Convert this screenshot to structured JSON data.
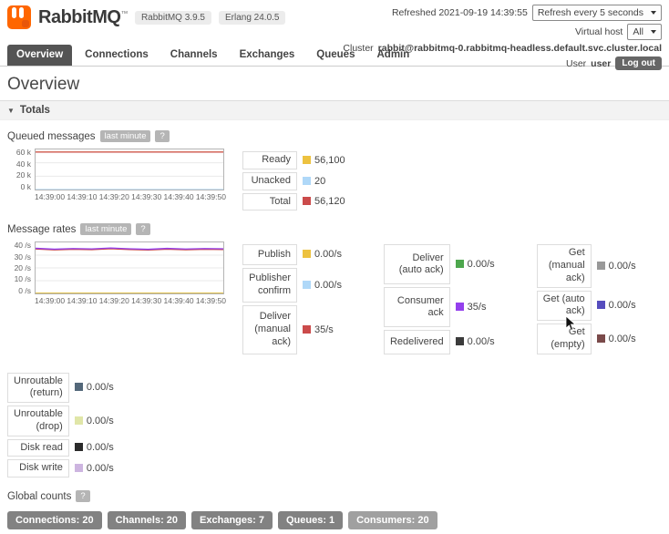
{
  "header": {
    "brand": "RabbitMQ",
    "tm": "™",
    "version_rabbitmq": "RabbitMQ 3.9.5",
    "version_erlang": "Erlang 24.0.5",
    "refreshed": "Refreshed 2021-09-19 14:39:55",
    "refresh_select": "Refresh every 5 seconds",
    "virtual_host_label": "Virtual host",
    "virtual_host_select": "All",
    "cluster_label": "Cluster",
    "cluster_value": "rabbit@rabbitmq-0.rabbitmq-headless.default.svc.cluster.local",
    "user_label": "User",
    "user_value": "user",
    "logout": "Log out"
  },
  "nav": {
    "tabs": [
      {
        "label": "Overview"
      },
      {
        "label": "Connections"
      },
      {
        "label": "Channels"
      },
      {
        "label": "Exchanges"
      },
      {
        "label": "Queues"
      },
      {
        "label": "Admin"
      }
    ]
  },
  "page": {
    "title": "Overview"
  },
  "totals": {
    "label": "Totals",
    "caret": "▼"
  },
  "queued": {
    "range_badge": "last minute",
    "help": "?",
    "legend": [
      {
        "label": "Ready",
        "value": "56,100",
        "color": "#edc240"
      },
      {
        "label": "Unacked",
        "value": "20",
        "color": "#afd8f8"
      },
      {
        "label": "Total",
        "value": "56,120",
        "color": "#cb4b4b"
      }
    ]
  },
  "rates": {
    "range_badge": "last minute",
    "help": "?",
    "columns": [
      {
        "rows": [
          {
            "label": "Publish",
            "value": "0.00/s",
            "color": "#edc240"
          },
          {
            "label": "Publisher confirm",
            "value": "0.00/s",
            "color": "#afd8f8"
          },
          {
            "label": "Deliver (manual ack)",
            "value": "35/s",
            "color": "#cb4b4b"
          }
        ]
      },
      {
        "rows": [
          {
            "label": "Deliver (auto ack)",
            "value": "0.00/s",
            "color": "#4da74d"
          },
          {
            "label": "Consumer ack",
            "value": "35/s",
            "color": "#9440ed"
          },
          {
            "label": "Redelivered",
            "value": "0.00/s",
            "color": "#3b3b3b"
          }
        ]
      },
      {
        "rows": [
          {
            "label": "Get (manual ack)",
            "value": "0.00/s",
            "color": "#999999"
          },
          {
            "label": "Get (auto ack)",
            "value": "0.00/s",
            "color": "#564dbe"
          },
          {
            "label": "Get (empty)",
            "value": "0.00/s",
            "color": "#7a4a4a"
          }
        ]
      }
    ],
    "extra": [
      {
        "label": "Unroutable (return)",
        "value": "0.00/s",
        "color": "#54687a"
      },
      {
        "label": "Unroutable (drop)",
        "value": "0.00/s",
        "color": "#e0e6a8"
      },
      {
        "label": "Disk read",
        "value": "0.00/s",
        "color": "#2b2b2b"
      },
      {
        "label": "Disk write",
        "value": "0.00/s",
        "color": "#cdb5e0"
      }
    ]
  },
  "global_counts": {
    "title": "Global counts",
    "help": "?",
    "badges": [
      {
        "label": "Connections: 20",
        "color": "#828282"
      },
      {
        "label": "Channels: 20",
        "color": "#828282"
      },
      {
        "label": "Exchanges: 7",
        "color": "#828282"
      },
      {
        "label": "Queues: 1",
        "color": "#828282"
      },
      {
        "label": "Consumers: 20",
        "color": "#a0a0a0"
      }
    ]
  },
  "chart_data": [
    {
      "type": "line",
      "title": "Queued messages",
      "ylim": [
        0,
        60000
      ],
      "y_ticks": [
        "60 k",
        "40 k",
        "20 k",
        "0 k"
      ],
      "x_ticks": [
        "14:39:00",
        "14:39:10",
        "14:39:20",
        "14:39:30",
        "14:39:40",
        "14:39:50"
      ],
      "series": [
        {
          "name": "Total",
          "color": "#cb4b4b",
          "values": [
            56120,
            56118,
            56121,
            56119,
            56122,
            56120,
            56117,
            56121,
            56119,
            56120,
            56120
          ]
        },
        {
          "name": "Ready",
          "color": "#edc240",
          "values": [
            56100,
            56098,
            56101,
            56099,
            56102,
            56100,
            56097,
            56101,
            56099,
            56100,
            56100
          ]
        },
        {
          "name": "Unacked",
          "color": "#afd8f8",
          "values": [
            20,
            20,
            20,
            20,
            20,
            20,
            20,
            20,
            20,
            20,
            20
          ]
        }
      ]
    },
    {
      "type": "line",
      "title": "Message rates",
      "ylim": [
        0,
        40
      ],
      "y_ticks": [
        "40 /s",
        "30 /s",
        "20 /s",
        "10 /s",
        "0 /s"
      ],
      "x_ticks": [
        "14:39:00",
        "14:39:10",
        "14:39:20",
        "14:39:30",
        "14:39:40",
        "14:39:50"
      ],
      "series": [
        {
          "name": "Consumer ack",
          "color": "#9440ed",
          "values": [
            35.4,
            34.7,
            35.2,
            34.9,
            35.6,
            35.0,
            34.6,
            35.3,
            34.8,
            35.2,
            35.0
          ]
        },
        {
          "name": "Deliver (manual ack)",
          "color": "#cb4b4b",
          "values": [
            34.8,
            34.1,
            34.6,
            34.3,
            35.0,
            34.4,
            34.0,
            34.7,
            34.2,
            34.6,
            34.4
          ]
        },
        {
          "name": "Publish",
          "color": "#edc240",
          "values": [
            0.15,
            0.15,
            0.15,
            0.15,
            0.15,
            0.15,
            0.15,
            0.15,
            0.15,
            0.15,
            0.15
          ]
        },
        {
          "name": "Publisher confirm",
          "color": "#afd8f8",
          "values": [
            0.1,
            0.1,
            0.1,
            0.1,
            0.1,
            0.1,
            0.1,
            0.1,
            0.1,
            0.1,
            0.1
          ]
        },
        {
          "name": "Deliver (auto ack)",
          "color": "#4da74d",
          "values": [
            0.12,
            0.12,
            0.12,
            0.12,
            0.12,
            0.12,
            0.12,
            0.12,
            0.12,
            0.12,
            0.12
          ]
        }
      ]
    }
  ]
}
